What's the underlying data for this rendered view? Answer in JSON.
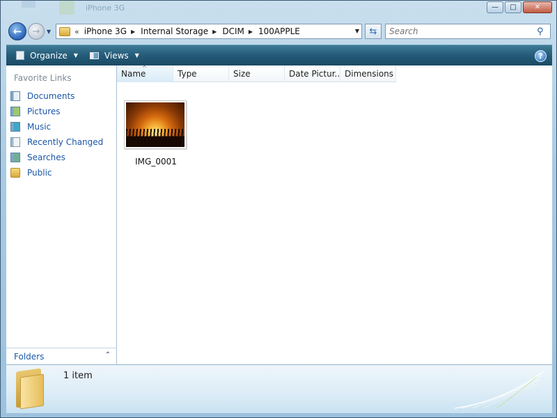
{
  "window": {
    "background_title": "iPhone 3G",
    "controls": {
      "minimize": "—",
      "maximize": "□",
      "close": "✕"
    }
  },
  "navigation": {
    "back_icon": "back-arrow-icon",
    "forward_icon": "forward-arrow-icon",
    "breadcrumbs": [
      "iPhone 3G",
      "Internal Storage",
      "DCIM",
      "100APPLE"
    ],
    "overflow_chevron": "«",
    "search_placeholder": "Search"
  },
  "command_bar": {
    "organize_label": "Organize",
    "views_label": "Views",
    "help_label": "?"
  },
  "sidebar": {
    "heading": "Favorite Links",
    "items": [
      {
        "label": "Documents",
        "icon": "documents-icon"
      },
      {
        "label": "Pictures",
        "icon": "pictures-icon"
      },
      {
        "label": "Music",
        "icon": "music-icon"
      },
      {
        "label": "Recently Changed",
        "icon": "recently-changed-icon"
      },
      {
        "label": "Searches",
        "icon": "searches-icon"
      },
      {
        "label": "Public",
        "icon": "public-folder-icon"
      }
    ],
    "folders_label": "Folders"
  },
  "content": {
    "columns": [
      "Name",
      "Type",
      "Size",
      "Date Pictur...",
      "Dimensions"
    ],
    "sorted_column": "Name",
    "files": [
      {
        "name": "IMG_0001",
        "thumbnail": "sunset-photo"
      }
    ]
  },
  "details": {
    "item_count": "1 item"
  },
  "colors": {
    "command_bar": "#245b78",
    "link_text": "#1a56a8",
    "heading_gray": "#7c8a97"
  }
}
